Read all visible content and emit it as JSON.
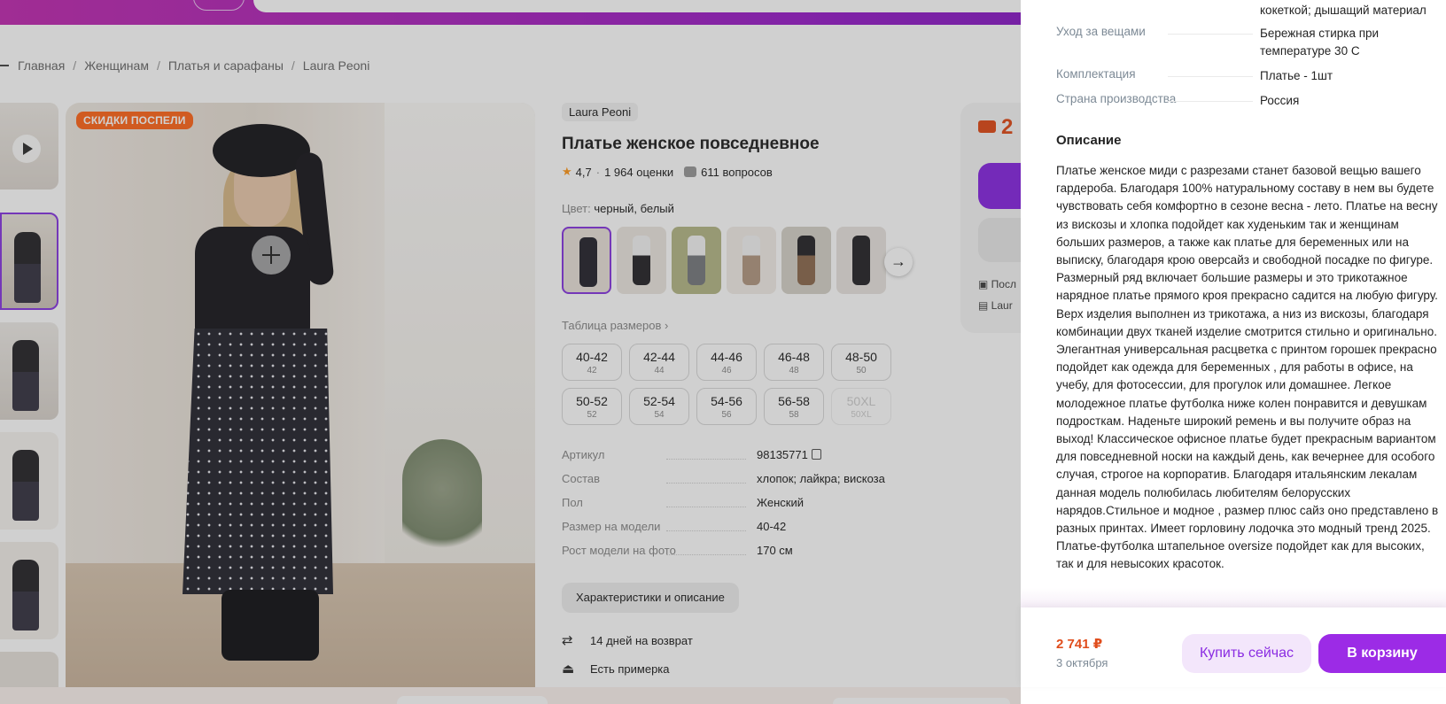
{
  "breadcrumbs": [
    "Главная",
    "Женщинам",
    "Платья и сарафаны",
    "Laura Peoni"
  ],
  "photo": {
    "badge": "СКИДКИ ПОСПЕЛИ"
  },
  "product": {
    "brand": "Laura Peoni",
    "title": "Платье женское повседневное",
    "rating": "4,7",
    "reviews": "1 964 оценки",
    "questions": "611 вопросов",
    "color_label": "Цвет:",
    "color_value": "черный, белый",
    "size_table_link": "Таблица размеров",
    "sizes": [
      {
        "label": "40-42",
        "ru": "42",
        "available": true
      },
      {
        "label": "42-44",
        "ru": "44",
        "available": true
      },
      {
        "label": "44-46",
        "ru": "46",
        "available": true
      },
      {
        "label": "46-48",
        "ru": "48",
        "available": true
      },
      {
        "label": "48-50",
        "ru": "50",
        "available": true
      },
      {
        "label": "50-52",
        "ru": "52",
        "available": true
      },
      {
        "label": "52-54",
        "ru": "54",
        "available": true
      },
      {
        "label": "54-56",
        "ru": "56",
        "available": true
      },
      {
        "label": "56-58",
        "ru": "58",
        "available": true
      },
      {
        "label": "50XL",
        "ru": "50XL",
        "available": false
      }
    ],
    "specs": [
      {
        "key": "Артикул",
        "value": "98135771"
      },
      {
        "key": "Состав",
        "value": "хлопок; лайкра; вискоза"
      },
      {
        "key": "Пол",
        "value": "Женский"
      },
      {
        "key": "Размер на модели",
        "value": "40-42"
      },
      {
        "key": "Рост модели на фото",
        "value": "170 см"
      }
    ],
    "characteristics_button": "Характеристики и описание",
    "perks": [
      "14 дней на возврат",
      "Есть примерка"
    ]
  },
  "buy_card": {
    "price_fragment": "2",
    "line1_fragment": "Посл",
    "line2_fragment": "Laur"
  },
  "drawer": {
    "rows": [
      {
        "key": "",
        "value": "кокеткой; дышащий материал"
      },
      {
        "key": "Уход за вещами",
        "value": "Бережная стирка при температуре 30 С"
      },
      {
        "key": "Комплектация",
        "value": "Платье - 1шт"
      },
      {
        "key": "Страна производства",
        "value": "Россия"
      }
    ],
    "description_title": "Описание",
    "description": "Платье женское миди с разрезами станет базовой вещью вашего гардероба. Благодаря 100% натуральному составу в нем вы будете чувствовать себя комфортно в сезоне весна - лето. Платье на весну из вискозы и хлопка подойдет как худеньким так и женщинам больших размеров, а также как платье для беременных или на выписку, благодаря крою оверсайз и свободной посадке по фигуре. Размерный ряд включает большие размеры и это трикотажное нарядное платье прямого кроя прекрасно садится на любую фигуру. Верх изделия выполнен из трикотажа, а низ из вискозы, благодаря комбинации двух тканей изделие смотрится стильно и оригинально. Элегантная универсальная расцветка с принтом горошек прекрасно подойдет как одежда для беременных , для работы в офисе, на учебу, для фотосессии, для прогулок или домашнее. Легкое молодежное платье футболка ниже колен понравится и девушкам подросткам. Наденьте широкий ремень и вы получите образ на выход! Классическое офисное платье будет прекрасным вариантом для повседневной носки на каждый день, как вечернее для особого случая, строгое на корпоратив. Благодаря итальянским лекалам данная модель полюбилась любителям белорусских нарядов.Стильное и модное , размер плюс сайз оно представлено в разных принтах. Имеет горловину лодочка это модный тренд 2025. Платье-футболка штапельное oversize подойдет как для высоких, так и для невысоких красоток.",
    "footer": {
      "price": "2 741 ₽",
      "delivery": "3 октября",
      "buy_now": "Купить сейчас",
      "to_cart": "В корзину"
    }
  },
  "colors": {
    "accent": "#9c2be6",
    "price": "#e04d1c",
    "badge": "#ff6a1f"
  }
}
